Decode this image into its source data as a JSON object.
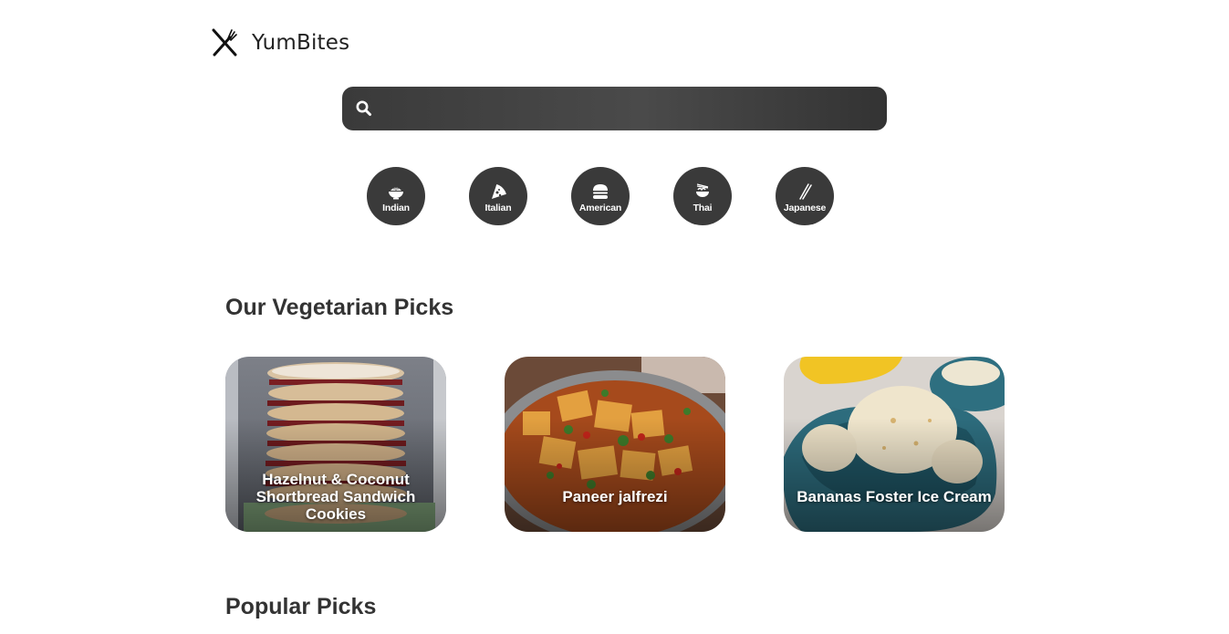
{
  "brand": {
    "name": "YumBites",
    "icon": "fork-knife-crossed-icon"
  },
  "search": {
    "placeholder": "",
    "value": "",
    "icon": "search-icon"
  },
  "cuisines": [
    {
      "label": "Indian",
      "icon": "rice-bowl-icon"
    },
    {
      "label": "Italian",
      "icon": "pizza-slice-icon"
    },
    {
      "label": "American",
      "icon": "burger-icon"
    },
    {
      "label": "Thai",
      "icon": "noodle-bowl-icon"
    },
    {
      "label": "Japanese",
      "icon": "chopsticks-icon"
    }
  ],
  "sections": {
    "vegetarian": {
      "title": "Our Vegetarian Picks",
      "cards": [
        {
          "title": "Hazelnut & Coconut Shortbread Sandwich Cookies"
        },
        {
          "title": "Paneer jalfrezi"
        },
        {
          "title": "Bananas Foster Ice Cream"
        }
      ]
    },
    "popular": {
      "title": "Popular Picks"
    }
  },
  "colors": {
    "dark": "#3a3a3a",
    "text": "#333333",
    "white": "#ffffff"
  }
}
